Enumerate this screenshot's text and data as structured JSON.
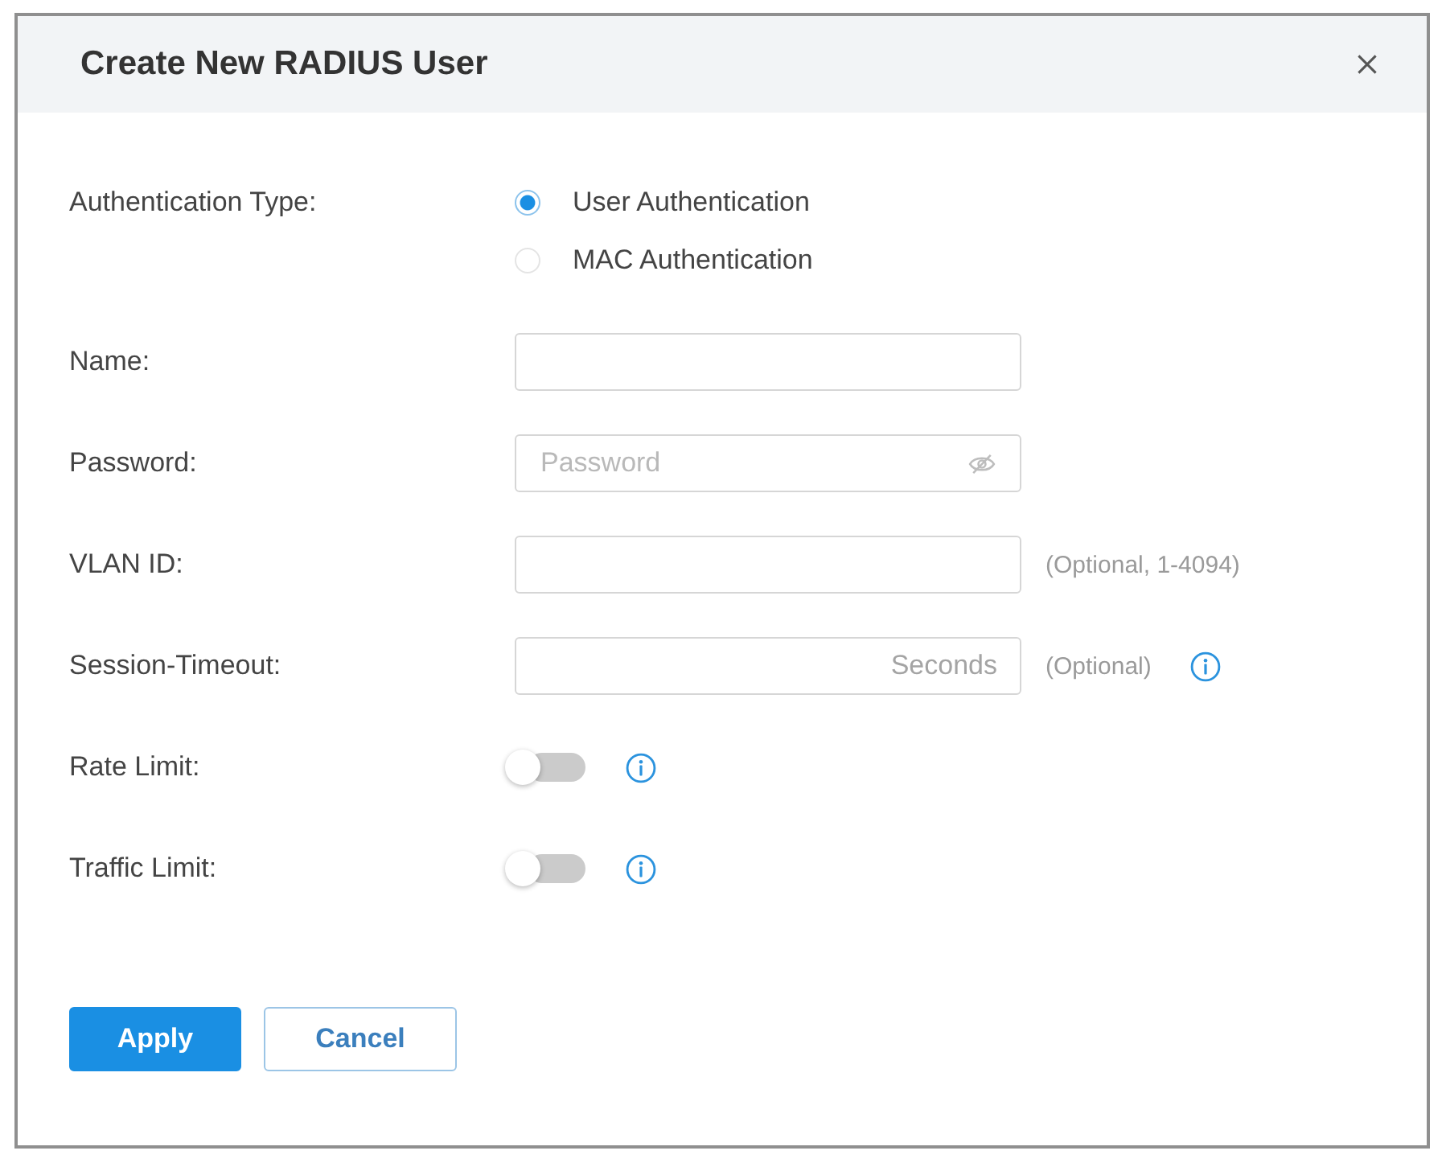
{
  "dialog": {
    "title": "Create New RADIUS User"
  },
  "fields": [
    {
      "kind": "radio",
      "label": "Authentication Type:",
      "options": [
        {
          "label": "User Authentication",
          "selected": true
        },
        {
          "label": "MAC Authentication",
          "selected": false
        }
      ]
    },
    {
      "kind": "text",
      "label": "Name:"
    },
    {
      "kind": "password",
      "label": "Password:",
      "placeholder": "Password"
    },
    {
      "kind": "number",
      "label": "VLAN ID:",
      "hint": "(Optional, 1-4094)"
    },
    {
      "kind": "number",
      "label": "Session-Timeout:",
      "placeholder": "Seconds",
      "hint": "(Optional)",
      "info": true
    },
    {
      "kind": "toggle",
      "label": "Rate Limit:",
      "on": false,
      "info": true
    },
    {
      "kind": "toggle",
      "label": "Traffic Limit:",
      "on": false,
      "info": true
    }
  ],
  "buttons": [
    {
      "label": "Apply",
      "kind": "primary"
    },
    {
      "label": "Cancel",
      "kind": "secondary"
    }
  ]
}
